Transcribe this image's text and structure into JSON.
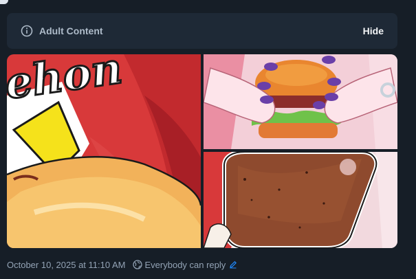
{
  "warning": {
    "label": "Adult Content",
    "hide_label": "Hide",
    "icon": "info-icon"
  },
  "media": {
    "count": 3,
    "images": [
      {
        "id": "image-1",
        "subject": "fried-food-illustration",
        "overlay_text": "ehon"
      },
      {
        "id": "image-2",
        "subject": "hands-holding-burger"
      },
      {
        "id": "image-3",
        "subject": "chocolate-ice-cream-bar"
      }
    ]
  },
  "meta": {
    "timestamp": "October 10, 2025 at 11:10 AM",
    "reply_setting": "Everybody can reply",
    "icons": [
      "globe-icon",
      "pencil-icon"
    ]
  },
  "colors": {
    "background": "#161e27",
    "warning_bg": "#1e2936",
    "accent": "#208bfe",
    "muted_text": "#93a3b5"
  }
}
